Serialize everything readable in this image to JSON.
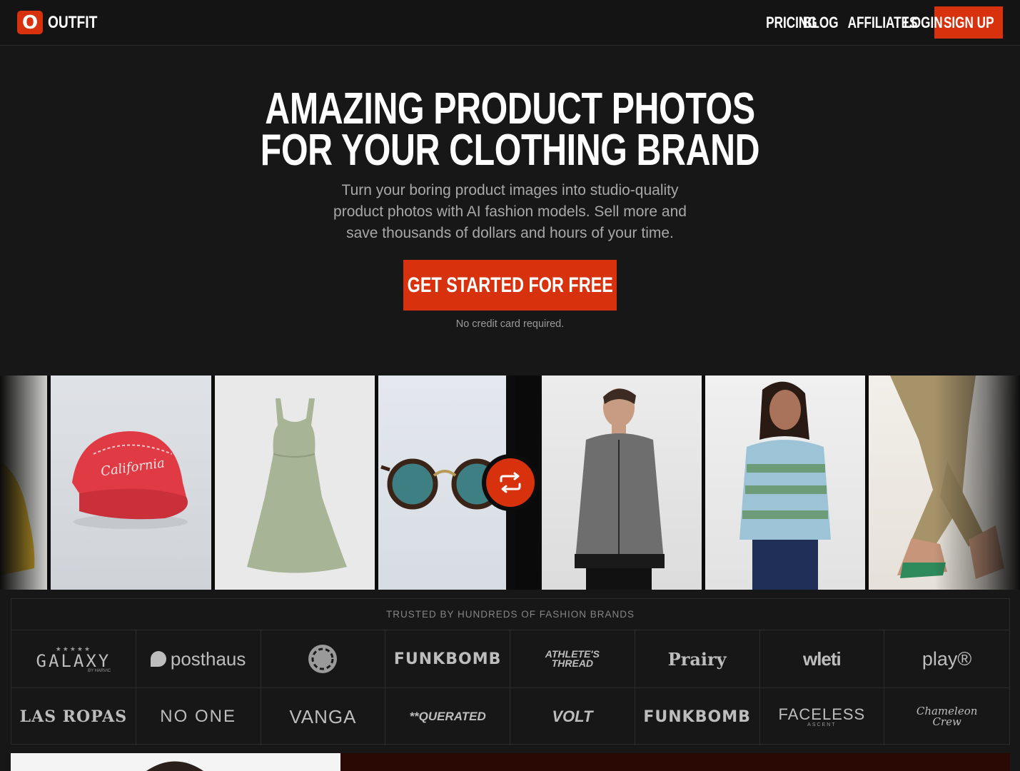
{
  "nav": {
    "logo_mark": "O",
    "logo_text": "OUTFIT",
    "links": [
      "PRICING",
      "BLOG",
      "AFFILIATES",
      "LOGIN"
    ],
    "signup": "SIGN UP"
  },
  "hero": {
    "title_lines": [
      "AMAZING PRODUCT PHOTOS",
      "FOR YOUR CLOTHING BRAND"
    ],
    "subtitle_lines": [
      "Turn your boring product images into studio-quality",
      "product photos with AI fashion models. Sell more and",
      "save thousands of dollars and hours of your time."
    ],
    "cta": "GET STARTED FOR FREE",
    "note": "No credit card required."
  },
  "gallery": {
    "cap_text": "California"
  },
  "brands": {
    "title": "TRUSTED BY HUNDREDS OF FASHION BRANDS",
    "row1": [
      "GALAXY",
      "posthaus",
      "",
      "FUNKBOMB",
      "ATHLETE'S THREAD",
      "Prairy",
      "wleti",
      "play®"
    ],
    "row2": [
      "LAS ROPAS",
      "NO ONE",
      "VANGA",
      "**QUERATED",
      "VOLT",
      "FUNKBOMB",
      "FACELESS",
      "Chameleon Crew"
    ],
    "galaxy_sub": "BY HARVIC",
    "faceless_sub": "ASCENT"
  },
  "colors": {
    "accent": "#d7310d",
    "background": "#171717"
  }
}
